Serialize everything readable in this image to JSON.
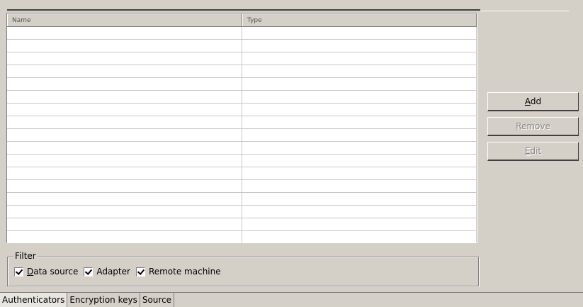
{
  "grid": {
    "columns": [
      "Name",
      "Type"
    ],
    "rows": 17
  },
  "buttons": {
    "add": {
      "mn": "A",
      "rest": "dd"
    },
    "remove": {
      "mn": "R",
      "rest": "emove"
    },
    "edit": {
      "mn": "E",
      "rest": "dit"
    }
  },
  "filter": {
    "legend": "Filter",
    "options": [
      {
        "mn": "D",
        "rest": "ata source",
        "checked": true
      },
      {
        "label": "Adapter",
        "checked": true
      },
      {
        "label": "Remote machine",
        "checked": true
      }
    ]
  },
  "tabs": [
    "Authenticators",
    "Encryption keys",
    "Source"
  ]
}
